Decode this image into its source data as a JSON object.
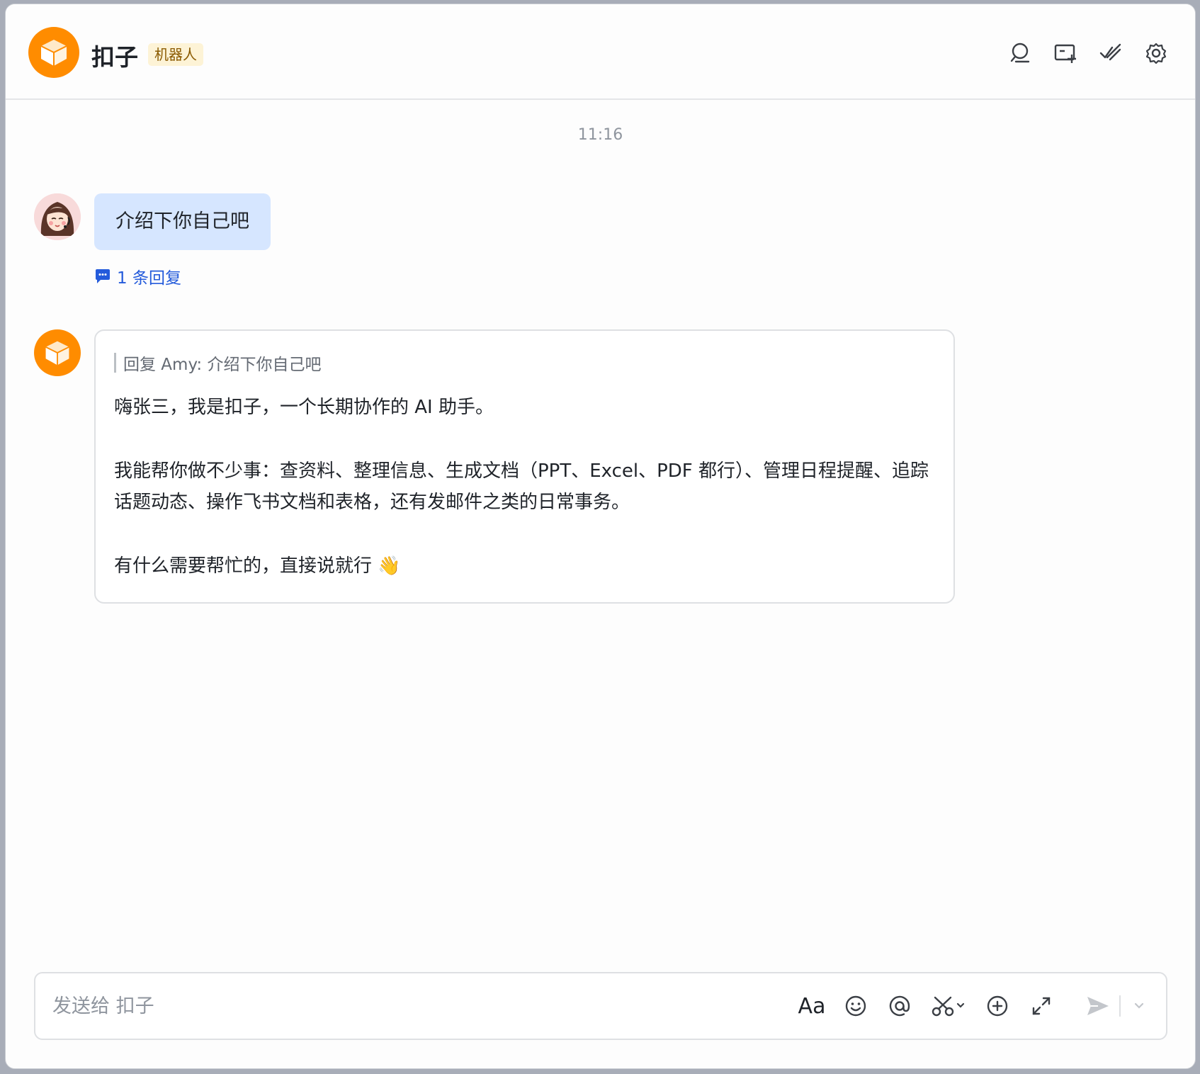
{
  "header": {
    "title": "扣子",
    "badge": "机器人",
    "icons": [
      "search-icon",
      "add-tab-icon",
      "checkmarks-icon",
      "settings-gear-icon"
    ]
  },
  "chat": {
    "timestamp": "11:16",
    "user_message": {
      "text": "介绍下你自己吧",
      "reply_count_label": "1 条回复"
    },
    "bot_message": {
      "quote": "回复 Amy: 介绍下你自己吧",
      "paragraphs": [
        "嗨张三，我是扣子，一个长期协作的 AI 助手。",
        "我能帮你做不少事：查资料、整理信息、生成文档（PPT、Excel、PDF 都行）、管理日程提醒、追踪话题动态、操作飞书文档和表格，还有发邮件之类的日常事务。",
        "有什么需要帮忙的，直接说就行 👋"
      ]
    }
  },
  "composer": {
    "placeholder": "发送给 扣子",
    "value": "",
    "format_label": "Aa",
    "tools": [
      "text-format-icon",
      "emoji-icon",
      "mention-icon",
      "screenshot-scissors-icon",
      "add-icon",
      "expand-icon",
      "send-icon",
      "dropdown-chevron-icon"
    ]
  },
  "colors": {
    "brand_orange": "#ff8c00",
    "user_bubble": "#d6e6ff",
    "link_blue": "#245bdb",
    "badge_bg": "#fdf3d6"
  }
}
